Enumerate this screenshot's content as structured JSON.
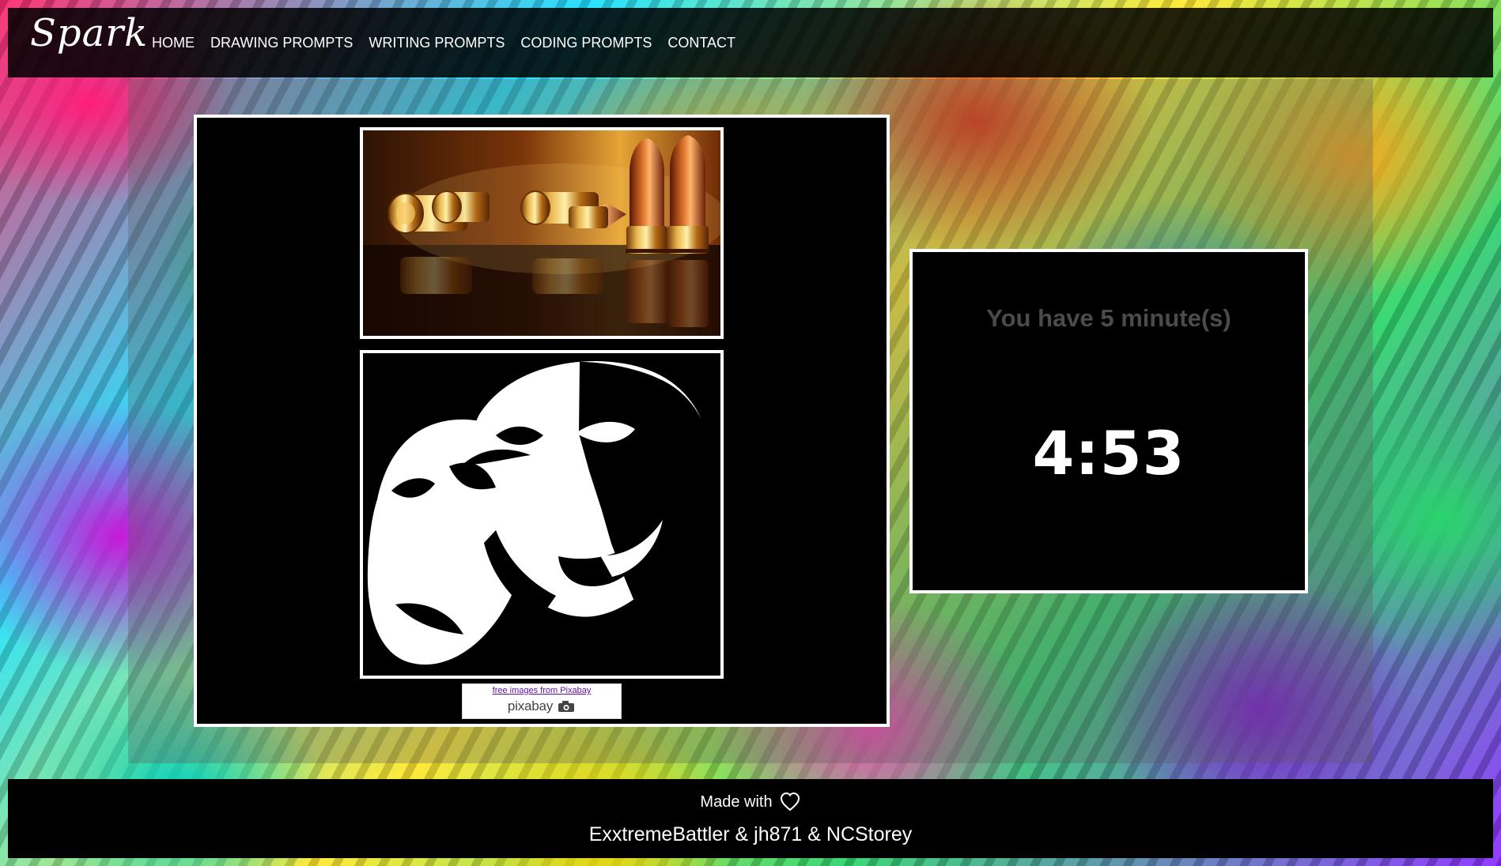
{
  "header": {
    "brand": "Spark",
    "nav": [
      {
        "label": "HOME"
      },
      {
        "label": "DRAWING PROMPTS"
      },
      {
        "label": "WRITING PROMPTS"
      },
      {
        "label": "CODING PROMPTS"
      },
      {
        "label": "CONTACT"
      }
    ]
  },
  "prompt_images": {
    "top_icon": "bullets-image",
    "bottom_icon": "theatre-masks-image"
  },
  "credit": {
    "link": "free images from Pixabay",
    "logo": "pixabay"
  },
  "timer": {
    "label": "You have 5 minute(s)",
    "value": "4:53"
  },
  "footer": {
    "made_with": "Made with",
    "authors": "ExxtremeBattler & jh871 & NCStorey"
  },
  "colors": {
    "page_overlay": "#000000",
    "frame_border": "#ffffff",
    "timer_label": "#4b4b4b"
  }
}
